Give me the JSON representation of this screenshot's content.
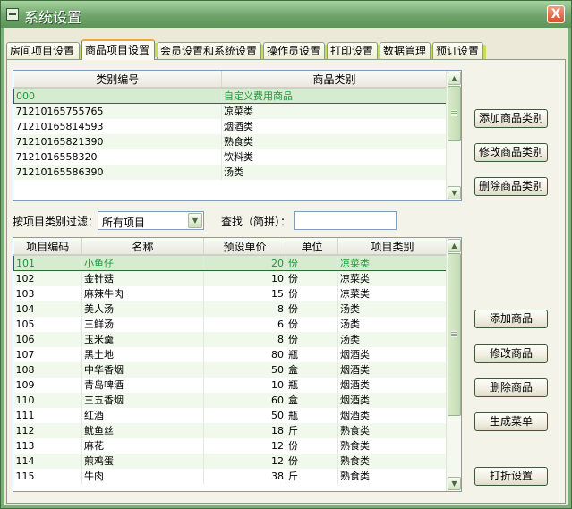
{
  "window": {
    "title": "系统设置",
    "close_label": "X"
  },
  "tabs": [
    {
      "label": "房间项目设置",
      "active": false
    },
    {
      "label": "商品项目设置",
      "active": true
    },
    {
      "label": "会员设置和系统设置",
      "active": false
    },
    {
      "label": "操作员设置",
      "active": false
    },
    {
      "label": "打印设置",
      "active": false
    },
    {
      "label": "数据管理",
      "active": false
    },
    {
      "label": "预订设置",
      "active": false
    }
  ],
  "category_grid": {
    "columns": [
      "类别编号",
      "商品类别"
    ],
    "rows": [
      [
        "000",
        "自定义费用商品"
      ],
      [
        "71210165755765",
        "凉菜类"
      ],
      [
        "71210165814593",
        "烟酒类"
      ],
      [
        "71210165821390",
        "熟食类"
      ],
      [
        "7121016558320",
        "饮料类"
      ],
      [
        "71210165586390",
        "汤类"
      ]
    ],
    "selected_row": 0
  },
  "category_buttons": {
    "add": "添加商品类别",
    "edit": "修改商品类别",
    "delete": "删除商品类别"
  },
  "filter": {
    "label": "按项目类别过滤：",
    "value": "所有项目",
    "search_label": "查找（简拼）：",
    "search_value": ""
  },
  "item_grid": {
    "columns": [
      "项目编码",
      "名称",
      "预设单价",
      "单位",
      "项目类别"
    ],
    "rows": [
      [
        "101",
        "小鱼仔",
        "20",
        "份",
        "凉菜类"
      ],
      [
        "102",
        "金针菇",
        "10",
        "份",
        "凉菜类"
      ],
      [
        "103",
        "麻辣牛肉",
        "15",
        "份",
        "凉菜类"
      ],
      [
        "104",
        "美人汤",
        "8",
        "份",
        "汤类"
      ],
      [
        "105",
        "三鲜汤",
        "6",
        "份",
        "汤类"
      ],
      [
        "106",
        "玉米羹",
        "8",
        "份",
        "汤类"
      ],
      [
        "107",
        "黑土地",
        "80",
        "瓶",
        "烟酒类"
      ],
      [
        "108",
        "中华香烟",
        "50",
        "盒",
        "烟酒类"
      ],
      [
        "109",
        "青岛啤酒",
        "10",
        "瓶",
        "烟酒类"
      ],
      [
        "110",
        "三五香烟",
        "60",
        "盒",
        "烟酒类"
      ],
      [
        "111",
        "红酒",
        "50",
        "瓶",
        "烟酒类"
      ],
      [
        "112",
        "鱿鱼丝",
        "18",
        "斤",
        "熟食类"
      ],
      [
        "113",
        "麻花",
        "12",
        "份",
        "熟食类"
      ],
      [
        "114",
        "煎鸡蛋",
        "12",
        "份",
        "熟食类"
      ],
      [
        "115",
        "牛肉",
        "38",
        "斤",
        "熟食类"
      ]
    ],
    "selected_row": 0
  },
  "item_buttons": {
    "add": "添加商品",
    "edit": "修改商品",
    "delete": "删除商品",
    "menu": "生成菜单",
    "discount": "打折设置"
  }
}
